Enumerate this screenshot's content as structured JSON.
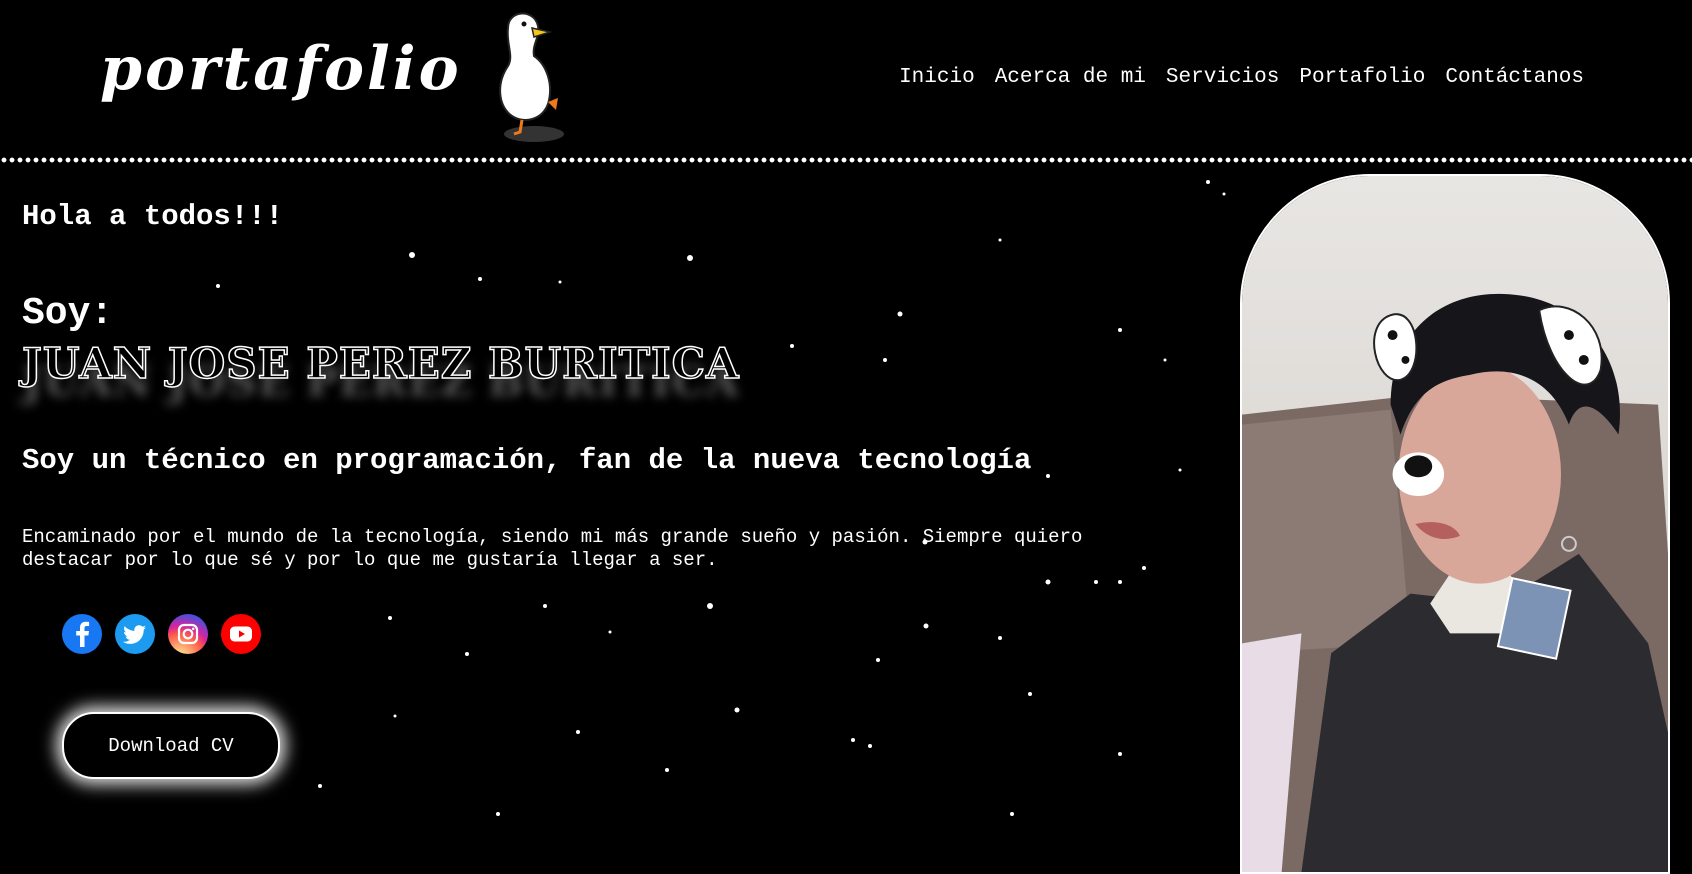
{
  "header": {
    "brand": "portafolio",
    "logo_icon": "duck-icon",
    "nav": [
      "Inicio",
      "Acerca de mi",
      "Servicios",
      "Portafolio",
      "Contáctanos"
    ]
  },
  "hero": {
    "greeting": "Hola a todos!!!",
    "intro": "Soy:",
    "name": "JUAN JOSE PEREZ BURITICA",
    "subtitle": "Soy un técnico en programación, fan de la nueva tecnología",
    "description": "Encaminado por el mundo de la tecnología, siendo mi más grande sueño y pasión. Siempre quiero destacar por lo que sé y por lo que me gustaría llegar a ser.",
    "socials": [
      {
        "icon": "facebook-icon",
        "color": "#1877f2"
      },
      {
        "icon": "twitter-icon",
        "color": "#1d9bf0"
      },
      {
        "icon": "instagram-icon",
        "color": "#d6249f"
      },
      {
        "icon": "youtube-icon",
        "color": "#ff0000"
      }
    ],
    "cv_button": "Download CV"
  },
  "profile_photo": {
    "icon": "profile-photo"
  },
  "colors": {
    "background": "#000000",
    "text": "#ffffff",
    "accent_glow": "#ffffff"
  }
}
